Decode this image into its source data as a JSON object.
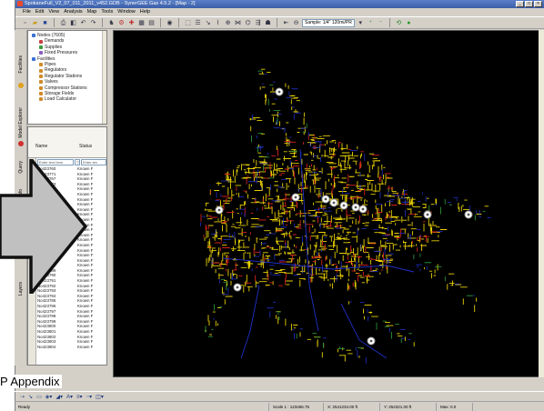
{
  "window": {
    "title": "SpokaneFull_V2_07_011_2011_v452.GDB - SynerGEE Gas 4.5.2 - [Map - 2]",
    "controls": [
      "_",
      "□",
      "×"
    ]
  },
  "menu": [
    "File",
    "Edit",
    "View",
    "Analysis",
    "Map",
    "Tools",
    "Window",
    "Help"
  ],
  "toolbar": {
    "map_combo": "Sample: 1/4\" 120mi/PR"
  },
  "dock_tabs": [
    "Facilities",
    "Model Explorer",
    "Query",
    "Info",
    "Layers"
  ],
  "tree": [
    {
      "label": "Nodes (7605)",
      "indent": 0,
      "color": "#3b6fd4"
    },
    {
      "label": "Demands",
      "indent": 1,
      "color": "#c84040"
    },
    {
      "label": "Supplies",
      "indent": 1,
      "color": "#3c9a3c"
    },
    {
      "label": "Fixed Pressures",
      "indent": 1,
      "color": "#8a5fc2"
    },
    {
      "label": "Facilities",
      "indent": 0,
      "color": "#3b6fd4"
    },
    {
      "label": "Pipes",
      "indent": 1,
      "color": "#d08a2a"
    },
    {
      "label": "Regulators",
      "indent": 1,
      "color": "#d08a2a"
    },
    {
      "label": "Regulator Stations",
      "indent": 1,
      "color": "#d08a2a"
    },
    {
      "label": "Valves",
      "indent": 1,
      "color": "#d08a2a"
    },
    {
      "label": "Compressor Stations",
      "indent": 1,
      "color": "#d08a2a"
    },
    {
      "label": "Storage Fields",
      "indent": 1,
      "color": "#d08a2a"
    },
    {
      "label": "Load Calculator",
      "indent": 1,
      "color": "#d08a2a"
    }
  ],
  "list": {
    "col_name": "Name",
    "col_status": "Status",
    "filter_name": "Enter text here",
    "filter_status": "Enter tex",
    "rows": [
      [
        "No423760",
        "Known F"
      ],
      [
        "No423771",
        "Known F"
      ],
      [
        "No423767",
        "Known F"
      ],
      [
        "No423773",
        "Known F"
      ],
      [
        "No423772",
        "Known F"
      ],
      [
        "No423774",
        "Known F"
      ],
      [
        "No423775",
        "Known F"
      ],
      [
        "No423776",
        "Known F"
      ],
      [
        "No423777",
        "Known F"
      ],
      [
        "No423778",
        "Known F"
      ],
      [
        "No423779",
        "Known F"
      ],
      [
        "No423780",
        "Known F"
      ],
      [
        "No423781",
        "Known F"
      ],
      [
        "No423782",
        "Known F"
      ],
      [
        "No423783",
        "Known F"
      ],
      [
        "No423784",
        "Known F"
      ],
      [
        "No423785",
        "Known F"
      ],
      [
        "No423786",
        "Known F"
      ],
      [
        "No423787",
        "Known F"
      ],
      [
        "No423788",
        "Known F"
      ],
      [
        "No423789",
        "Known F"
      ],
      [
        "No423790",
        "Known F"
      ],
      [
        "No423791",
        "Known F"
      ],
      [
        "No423792",
        "Known F"
      ],
      [
        "No423793",
        "Known F"
      ],
      [
        "No423794",
        "Known F"
      ],
      [
        "No423795",
        "Known F"
      ],
      [
        "No423796",
        "Known F"
      ],
      [
        "No423797",
        "Known F"
      ],
      [
        "No423798",
        "Known F"
      ],
      [
        "No423799",
        "Known F"
      ],
      [
        "No423800",
        "Known F"
      ],
      [
        "No423801",
        "Known F"
      ],
      [
        "No423802",
        "Known F"
      ],
      [
        "No423803",
        "Known F"
      ],
      [
        "No423804",
        "Known F"
      ]
    ]
  },
  "caption": "P Appendix",
  "status": {
    "left": "Ready",
    "scale": "Scale 1 : 123456.75",
    "x": "X: 2541234.00 ft",
    "y": "Y: 254321.00 ft",
    "extra": "Max: 0.0"
  },
  "colors": {
    "map_background": "#000000",
    "network_primary": "#e8d000",
    "network_secondary": "#d42020",
    "network_mains": "#2030c8",
    "network_misc": "#30a040",
    "arrow_fill": "#c0c0c0",
    "title_bar": "#3b5ea8"
  }
}
